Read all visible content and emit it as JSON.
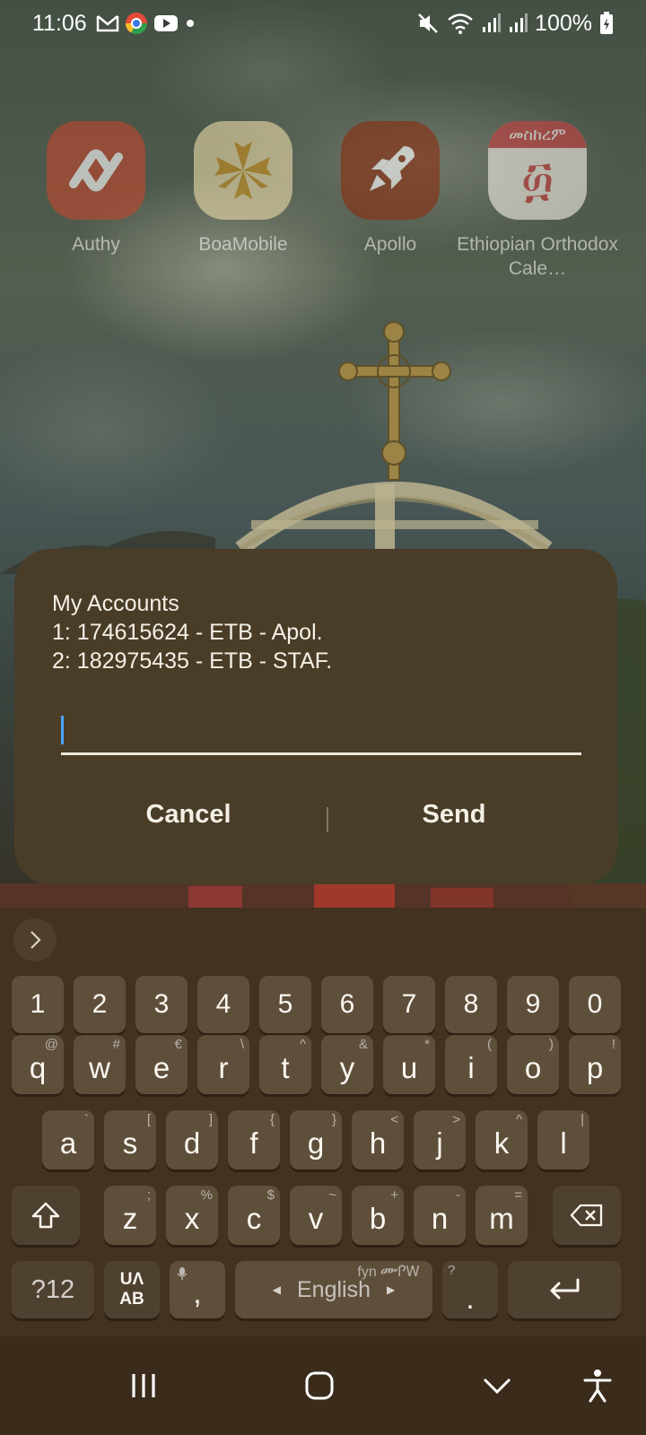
{
  "status_bar": {
    "time": "11:06",
    "battery": "100%",
    "icons": [
      "gmail-icon",
      "chrome-icon",
      "youtube-icon",
      "notification-dot-icon",
      "mute-icon",
      "wifi-icon",
      "signal-icon",
      "signal-icon",
      "battery-charging-icon"
    ]
  },
  "home": {
    "apps": [
      {
        "label": "Authy",
        "icon": "authy-icon",
        "color": "#c0472e"
      },
      {
        "label": "BoaMobile",
        "icon": "boa-icon",
        "color": "#e9d9a8"
      },
      {
        "label": "Apollo",
        "icon": "rocket-icon",
        "color": "#8a2e10"
      },
      {
        "label": "Ethiopian Orthodox Cale…",
        "icon": "calendar-icon",
        "color": "#c84040",
        "icon_text": "መስከረም",
        "icon_glyph": "፴"
      }
    ]
  },
  "dialog": {
    "lines": [
      "My Accounts",
      "1: 174615624 - ETB - Apol.",
      "2: 182975435 - ETB - STAF."
    ],
    "input_value": "",
    "cancel_label": "Cancel",
    "send_label": "Send"
  },
  "keyboard": {
    "number_row": [
      "1",
      "2",
      "3",
      "4",
      "5",
      "6",
      "7",
      "8",
      "9",
      "0"
    ],
    "row1": [
      {
        "k": "q",
        "s": "@"
      },
      {
        "k": "w",
        "s": "#"
      },
      {
        "k": "e",
        "s": "€"
      },
      {
        "k": "r",
        "s": "\\"
      },
      {
        "k": "t",
        "s": "^"
      },
      {
        "k": "y",
        "s": "&"
      },
      {
        "k": "u",
        "s": "*"
      },
      {
        "k": "i",
        "s": "("
      },
      {
        "k": "o",
        "s": ")"
      },
      {
        "k": "p",
        "s": "!"
      }
    ],
    "row2": [
      {
        "k": "a",
        "s": "`"
      },
      {
        "k": "s",
        "s": "["
      },
      {
        "k": "d",
        "s": "]"
      },
      {
        "k": "f",
        "s": "{"
      },
      {
        "k": "g",
        "s": "}"
      },
      {
        "k": "h",
        "s": "<"
      },
      {
        "k": "j",
        "s": ">"
      },
      {
        "k": "k",
        "s": "^"
      },
      {
        "k": "l",
        "s": "|"
      }
    ],
    "row3": [
      {
        "k": "z",
        "s": ";"
      },
      {
        "k": "x",
        "s": "%"
      },
      {
        "k": "c",
        "s": "$"
      },
      {
        "k": "v",
        "s": "~"
      },
      {
        "k": "b",
        "s": "+"
      },
      {
        "k": "n",
        "s": "-"
      },
      {
        "k": "m",
        "s": "="
      }
    ],
    "symbols_label": "?12",
    "lang_switch_top": "UΛ",
    "lang_switch_bottom": "AB",
    "comma_label": ",",
    "space_label": "English",
    "space_sub": "fyn ᎀᎵᎳ",
    "period_label": ".",
    "period_sub": "?"
  },
  "nav": {
    "items": [
      "recents-icon",
      "home-icon",
      "hide-keyboard-icon",
      "accessibility-icon"
    ]
  }
}
